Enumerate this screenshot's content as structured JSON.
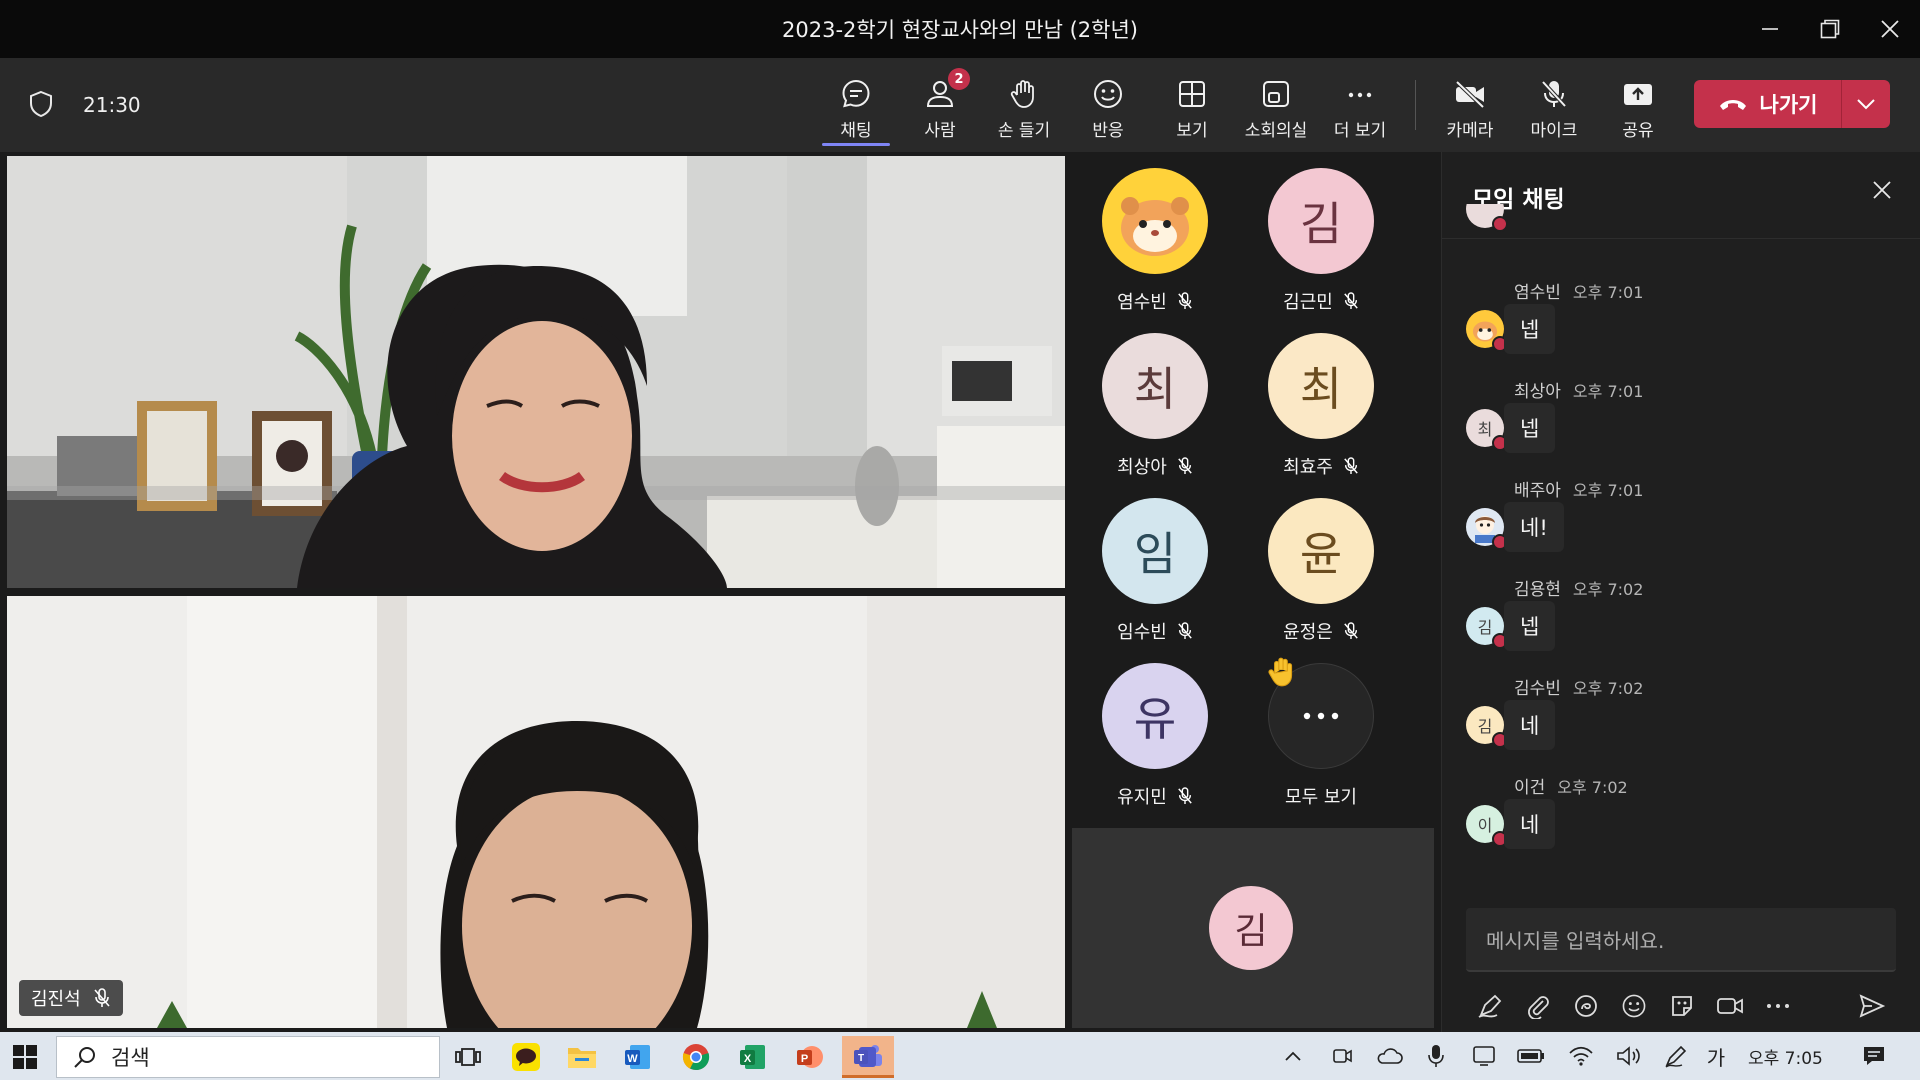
{
  "window": {
    "title": "2023-2학기 현장교사와의 만남 (2학년)",
    "minimize_icon": "minimize-icon",
    "restore_icon": "restore-icon",
    "close_icon": "close-icon"
  },
  "toolbar": {
    "timer": "21:30",
    "items": [
      {
        "label": "채팅",
        "icon": "chat-icon",
        "active": true
      },
      {
        "label": "사람",
        "icon": "people-icon",
        "badge": "2"
      },
      {
        "label": "손 들기",
        "icon": "raise-hand-icon"
      },
      {
        "label": "반응",
        "icon": "smile-icon"
      },
      {
        "label": "보기",
        "icon": "grid-icon"
      },
      {
        "label": "소회의실",
        "icon": "breakout-icon"
      },
      {
        "label": "더 보기",
        "icon": "more-icon"
      },
      {
        "label": "카메라",
        "icon": "camera-off-icon"
      },
      {
        "label": "마이크",
        "icon": "mic-off-icon"
      },
      {
        "label": "공유",
        "icon": "share-icon"
      }
    ],
    "leave_label": "나가기",
    "accent": "#7f85f5",
    "leave_color": "#c4314b"
  },
  "videos": [
    {
      "name": ""
    },
    {
      "name": "김진석"
    }
  ],
  "participants": [
    {
      "name": "염수빈",
      "initial": "",
      "color": "#ffd23a"
    },
    {
      "name": "김근민",
      "initial": "김",
      "color": "#f3c8d2"
    },
    {
      "name": "최상아",
      "initial": "최",
      "color": "#eadcdc"
    },
    {
      "name": "최효주",
      "initial": "최",
      "color": "#fbe8c6"
    },
    {
      "name": "임수빈",
      "initial": "임",
      "color": "#d3e6ee"
    },
    {
      "name": "윤정은",
      "initial": "윤",
      "color": "#fbe8c0"
    },
    {
      "name": "유지민",
      "initial": "유",
      "color": "#d9d3ef"
    },
    {
      "name": "모두 보기",
      "initial": "",
      "color": "#262626"
    }
  ],
  "spotlight": {
    "initial": "김"
  },
  "chat": {
    "title": "모임 채팅",
    "messages": [
      {
        "sender": "염수빈",
        "time": "오후 7:01",
        "text": "넵",
        "initial": "",
        "color": "#ffc93c"
      },
      {
        "sender": "최상아",
        "time": "오후 7:01",
        "text": "넵",
        "initial": "최",
        "color": "#eadcdc"
      },
      {
        "sender": "배주아",
        "time": "오후 7:01",
        "text": "네!",
        "initial": "",
        "color": "#dfe8f3"
      },
      {
        "sender": "김용현",
        "time": "오후 7:02",
        "text": "넵",
        "initial": "김",
        "color": "#d2eaf0"
      },
      {
        "sender": "김수빈",
        "time": "오후 7:02",
        "text": "네",
        "initial": "김",
        "color": "#fbe8c0"
      },
      {
        "sender": "이건",
        "time": "오후 7:02",
        "text": "네",
        "initial": "이",
        "color": "#d6f0e0"
      }
    ],
    "composer_placeholder": "메시지를 입력하세요."
  },
  "taskbar": {
    "search_label": "검색",
    "ime": "가",
    "clock": "오후 7:05"
  }
}
